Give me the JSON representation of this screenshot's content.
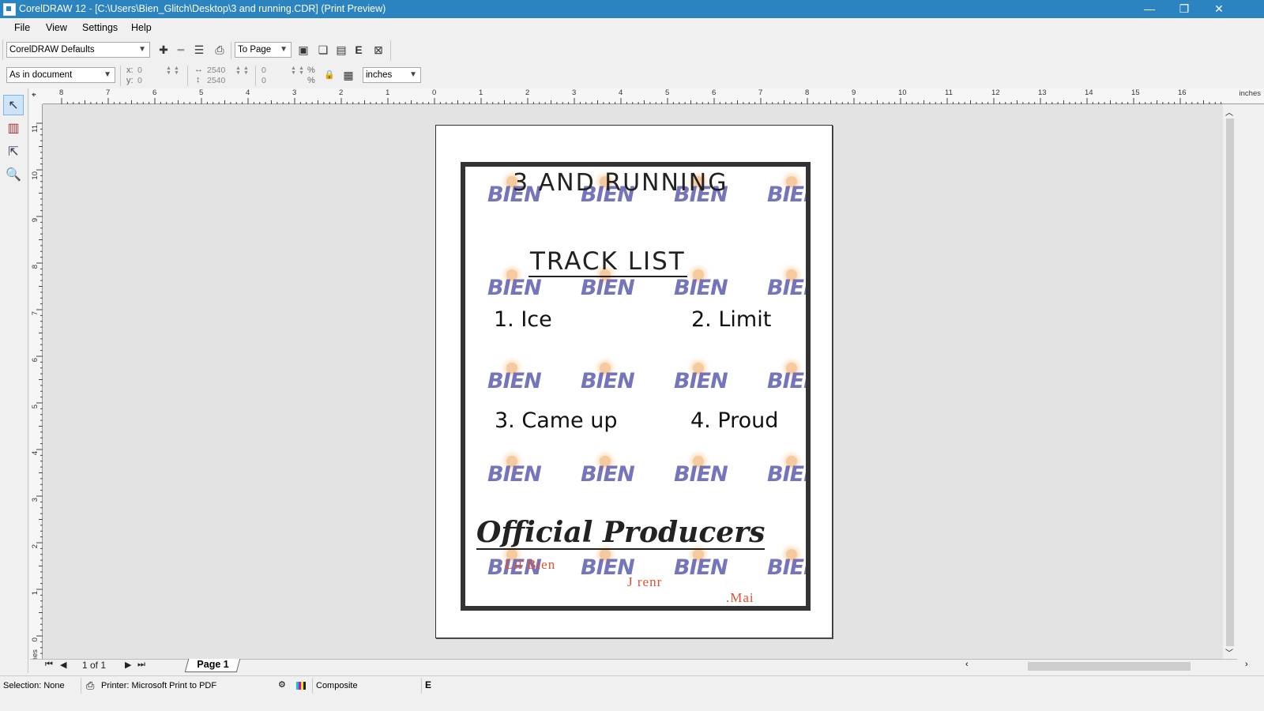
{
  "window": {
    "title": "CorelDRAW 12 - [C:\\Users\\Bien_Glitch\\Desktop\\3 and running.CDR] (Print Preview)",
    "minimize_glyph": "—",
    "restore_glyph": "❐",
    "close_glyph": "✕"
  },
  "menu": {
    "file": "File",
    "view": "View",
    "settings": "Settings",
    "help": "Help"
  },
  "toolbar": {
    "preset_value": "CorelDRAW Defaults",
    "zoom_value": "To Page",
    "position_value": "As in document",
    "x_label": "x:",
    "y_label": "y:",
    "x_value": "0",
    "y_value": "0",
    "width_value": "2540",
    "height_value": "2540",
    "scale_x_value": "0",
    "scale_y_value": "0",
    "percent_sign": "%",
    "units_value": "inches"
  },
  "ruler": {
    "units": "inches",
    "h_ticks": [
      "8",
      "7",
      "6",
      "5",
      "4",
      "3",
      "2",
      "1",
      "0",
      "1",
      "2",
      "3",
      "4",
      "5",
      "6",
      "7",
      "8",
      "9",
      "10",
      "11",
      "12",
      "13",
      "14",
      "15",
      "16"
    ],
    "v_ticks": [
      "11",
      "10",
      "9",
      "8",
      "7",
      "6",
      "5",
      "4",
      "3",
      "2",
      "1",
      "0"
    ]
  },
  "document": {
    "title": "3 AND RUNNING",
    "heading": "TRACK LIST",
    "tracks": [
      "1. Ice",
      "2. Limit",
      "3. Came up",
      "4. Proud"
    ],
    "producers_heading": "Official Producers",
    "producers": [
      "Lil Bien",
      "J renr",
      ".Mai"
    ],
    "watermark": "BIEN"
  },
  "pages": {
    "counter": "1 of 1",
    "tab": "Page 1"
  },
  "status": {
    "selection": "Selection: None",
    "printer": "Printer: Microsoft Print to PDF",
    "mode": "Composite"
  },
  "colors": {
    "titlebar": "#2b84c0",
    "watermark": "#5d5db0",
    "producer_text": "#e05030"
  }
}
